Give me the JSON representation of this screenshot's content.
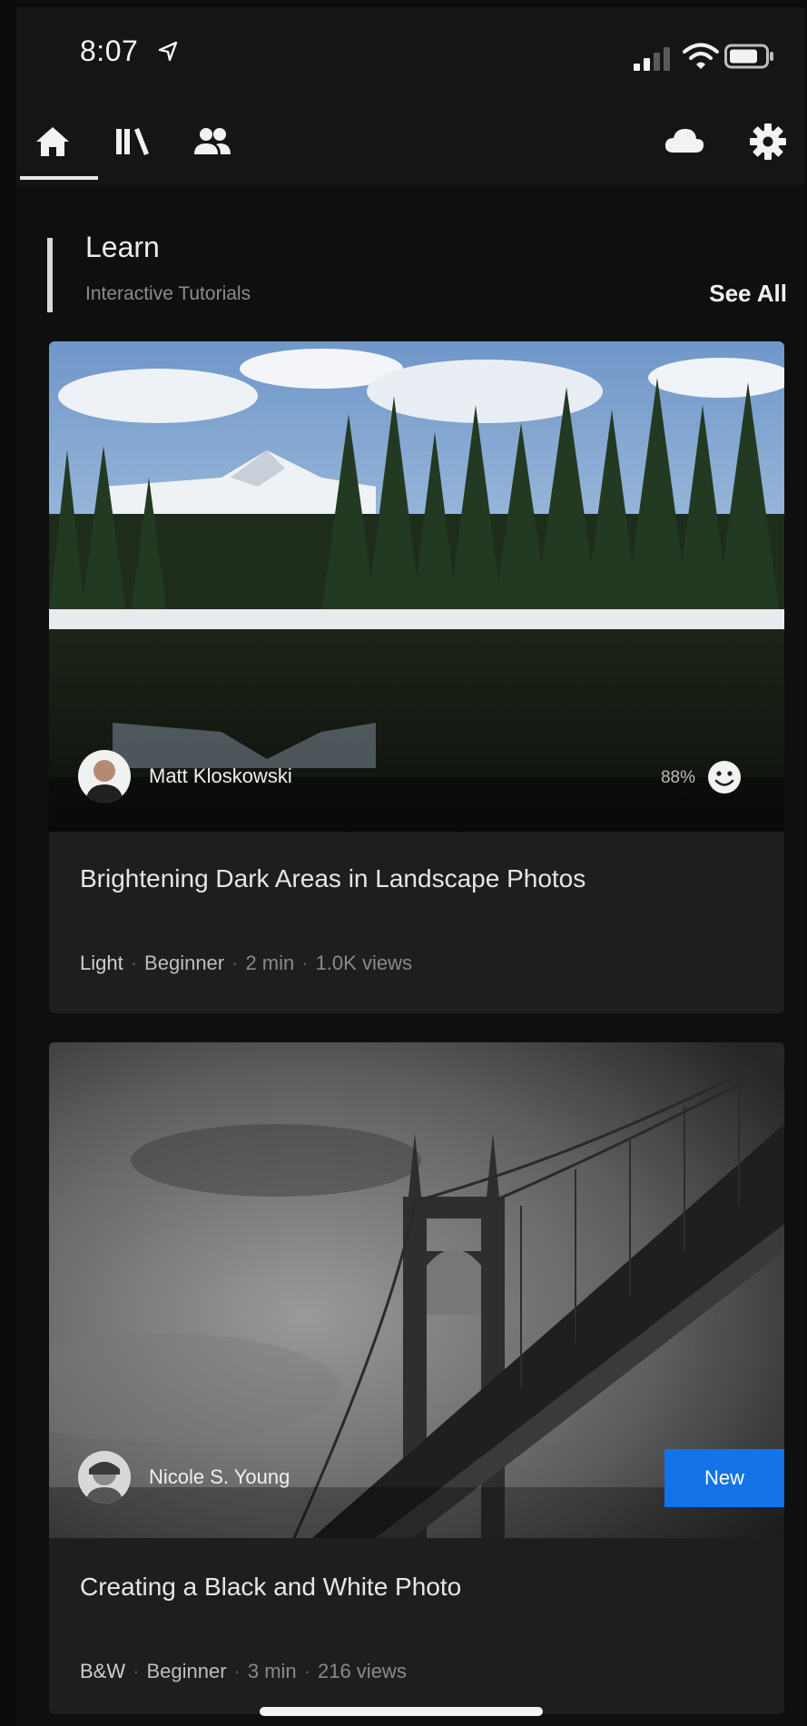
{
  "status_bar": {
    "time": "8:07"
  },
  "nav": {
    "tabs": [
      {
        "icon": "home-icon",
        "active": true
      },
      {
        "icon": "library-icon",
        "active": false
      },
      {
        "icon": "people-icon",
        "active": false
      }
    ],
    "right_icons": [
      "cloud-icon",
      "gear-icon"
    ]
  },
  "section": {
    "title": "Learn",
    "subtitle": "Interactive Tutorials",
    "see_all": "See All"
  },
  "cards": [
    {
      "author": "Matt Kloskowski",
      "score": "88%",
      "title": "Brightening Dark Areas in Landscape Photos",
      "category": "Light",
      "level": "Beginner",
      "duration": "2 min",
      "views": "1.0K views"
    },
    {
      "author": "Nicole S. Young",
      "badge": "New",
      "title": "Creating a Black and White Photo",
      "category": "B&W",
      "level": "Beginner",
      "duration": "3 min",
      "views": "216 views"
    }
  ],
  "colors": {
    "accent": "#1473e6",
    "background": "#0f0f0f",
    "card": "#1e1e1e"
  }
}
